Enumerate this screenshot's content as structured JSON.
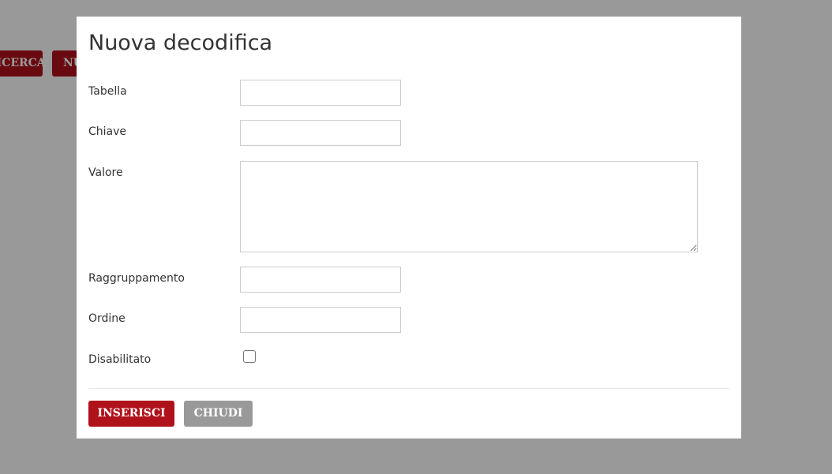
{
  "background": {
    "search_button_label": "RICERCA",
    "new_button_label": "NUOVO"
  },
  "modal": {
    "title": "Nuova decodifica",
    "fields": {
      "tabella": {
        "label": "Tabella",
        "value": ""
      },
      "chiave": {
        "label": "Chiave",
        "value": ""
      },
      "valore": {
        "label": "Valore",
        "value": ""
      },
      "raggruppamento": {
        "label": "Raggruppamento",
        "value": ""
      },
      "ordine": {
        "label": "Ordine",
        "value": ""
      },
      "disabilitato": {
        "label": "Disabilitato",
        "checked": false
      }
    },
    "buttons": {
      "insert_label": "INSERISCI",
      "close_label": "CHIUDI"
    }
  },
  "colors": {
    "primary": "#b0121b",
    "secondary": "#999999",
    "overlay": "rgba(0,0,0,0.4)"
  }
}
